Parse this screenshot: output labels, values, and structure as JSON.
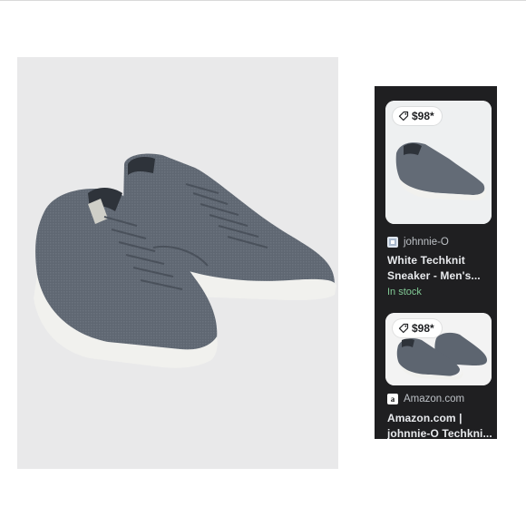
{
  "results": [
    {
      "price": "$98*",
      "source": "johnnie-O",
      "title_line1": "White Techknit",
      "title_line2": "Sneaker - Men's...",
      "availability": "In stock",
      "favicon": "johnnie-o-favicon-icon"
    },
    {
      "price": "$98*",
      "source": "Amazon.com",
      "title_line1": "Amazon.com |",
      "title_line2": "johnnie-O Techkni...",
      "favicon": "amazon-favicon-icon",
      "favicon_glyph": "a"
    }
  ],
  "colors": {
    "panel_bg": "#1f1f21",
    "photo_bg": "#e9e9ea",
    "shoe_knit": "#5d6570",
    "sole": "#f1f1ee",
    "in_stock": "#81c995"
  }
}
